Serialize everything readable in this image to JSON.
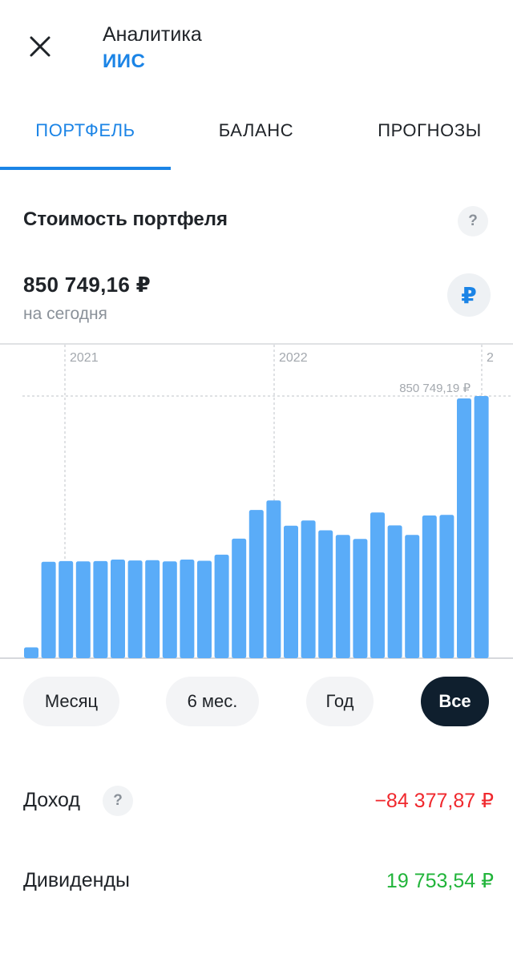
{
  "header": {
    "title": "Аналитика",
    "subtitle": "ИИС",
    "close_icon": "close-icon"
  },
  "tabs": [
    {
      "label": "ПОРТФЕЛЬ",
      "active": true
    },
    {
      "label": "БАЛАНС",
      "active": false
    },
    {
      "label": "ПРОГНОЗЫ",
      "active": false
    }
  ],
  "portfolio": {
    "title": "Стоимость портфеля",
    "help_label": "?",
    "value": "850 749,16 ₽",
    "value_caption": "на сегодня",
    "currency_symbol": "₽"
  },
  "chart_data": {
    "type": "bar",
    "x_labels": [
      "2021",
      "2022",
      "2"
    ],
    "max_label": "850 749,19 ₽",
    "values": [
      35000,
      313000,
      315000,
      314000,
      315000,
      320000,
      317000,
      318000,
      314000,
      320000,
      316000,
      336000,
      388000,
      481000,
      512000,
      430000,
      447000,
      415000,
      400000,
      387000,
      473000,
      431000,
      400000,
      463000,
      465000,
      843000,
      850749.19
    ],
    "ylim": [
      0,
      850749.19
    ],
    "grid": "vertical dashed at year boundaries, horizontal dashed at max",
    "color": "#5aacf8"
  },
  "periods": [
    {
      "label": "Месяц",
      "active": false
    },
    {
      "label": "6 мес.",
      "active": false
    },
    {
      "label": "Год",
      "active": false
    },
    {
      "label": "Все",
      "active": true
    }
  ],
  "stats": {
    "income_label": "Доход",
    "income_help": "?",
    "income_value": "−84 377,87 ₽",
    "income_color": "#f0282d",
    "dividends_label": "Дивиденды",
    "dividends_value": "19 753,54 ₽",
    "dividends_color": "#21b43a"
  },
  "colors": {
    "accent": "#1b84e6",
    "dark_button": "#0f1f2e"
  }
}
